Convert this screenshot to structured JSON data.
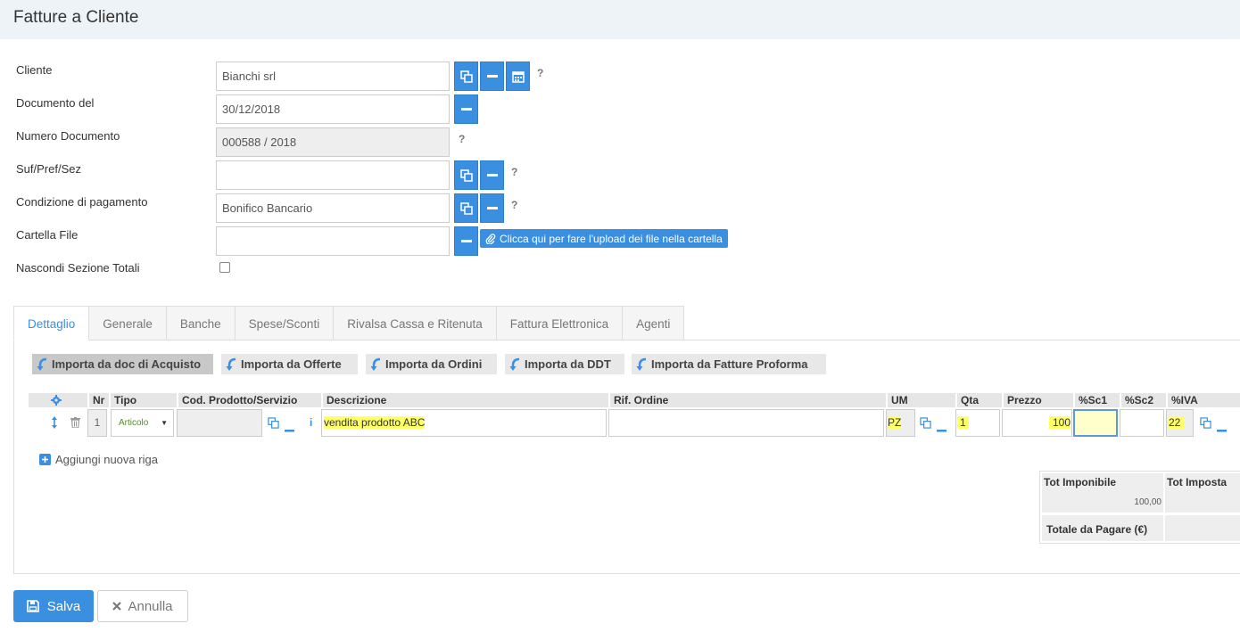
{
  "header": {
    "title": "Fatture a Cliente"
  },
  "form": {
    "cliente_label": "Cliente",
    "cliente_value": "Bianchi srl",
    "documento_label": "Documento del",
    "documento_value": "30/12/2018",
    "numero_label": "Numero Documento",
    "numero_value": "000588 / 2018",
    "suf_label": "Suf/Pref/Sez",
    "suf_value": "",
    "condizione_label": "Condizione di pagamento",
    "condizione_value": "Bonifico Bancario",
    "cartella_label": "Cartella File",
    "cartella_value": "",
    "upload_label": "Clicca qui per fare l'upload dei file nella cartella",
    "nascondi_label": "Nascondi Sezione Totali",
    "help": "?"
  },
  "tabs": [
    {
      "label": "Dettaglio"
    },
    {
      "label": "Generale"
    },
    {
      "label": "Banche"
    },
    {
      "label": "Spese/Sconti"
    },
    {
      "label": "Rivalsa Cassa e Ritenuta"
    },
    {
      "label": "Fattura Elettronica"
    },
    {
      "label": "Agenti"
    }
  ],
  "imports": [
    {
      "label": "Importa da doc di Acquisto"
    },
    {
      "label": "Importa da Offerte"
    },
    {
      "label": "Importa da Ordini"
    },
    {
      "label": "Importa da DDT"
    },
    {
      "label": "Importa da Fatture Proforma"
    }
  ],
  "grid": {
    "headers": {
      "nr": "Nr",
      "tipo": "Tipo",
      "cod": "Cod. Prodotto/Servizio",
      "descrizione": "Descrizione",
      "rif": "Rif. Ordine",
      "um": "UM",
      "qta": "Qta",
      "prezzo": "Prezzo",
      "sc1": "%Sc1",
      "sc2": "%Sc2",
      "iva": "%IVA"
    },
    "row": {
      "nr": "1",
      "tipo": "Articolo",
      "cod": "",
      "descrizione": "vendita prodotto ABC",
      "rif": "",
      "um": "PZ",
      "qta": "1",
      "prezzo": "100",
      "sc1": "",
      "sc2": "",
      "iva": "22"
    },
    "add_row": "Aggiungi nuova riga"
  },
  "totals": {
    "imponibile_label": "Tot Imponibile",
    "imponibile_value": "100,00",
    "imposta_label": "Tot Imposta",
    "pagare_label": "Totale da Pagare (€)"
  },
  "actions": {
    "save": "Salva",
    "cancel": "Annulla"
  },
  "colors": {
    "accent": "#3b8fe0",
    "highlight": "#ffff66",
    "tipo_text": "#5a8a2a"
  }
}
